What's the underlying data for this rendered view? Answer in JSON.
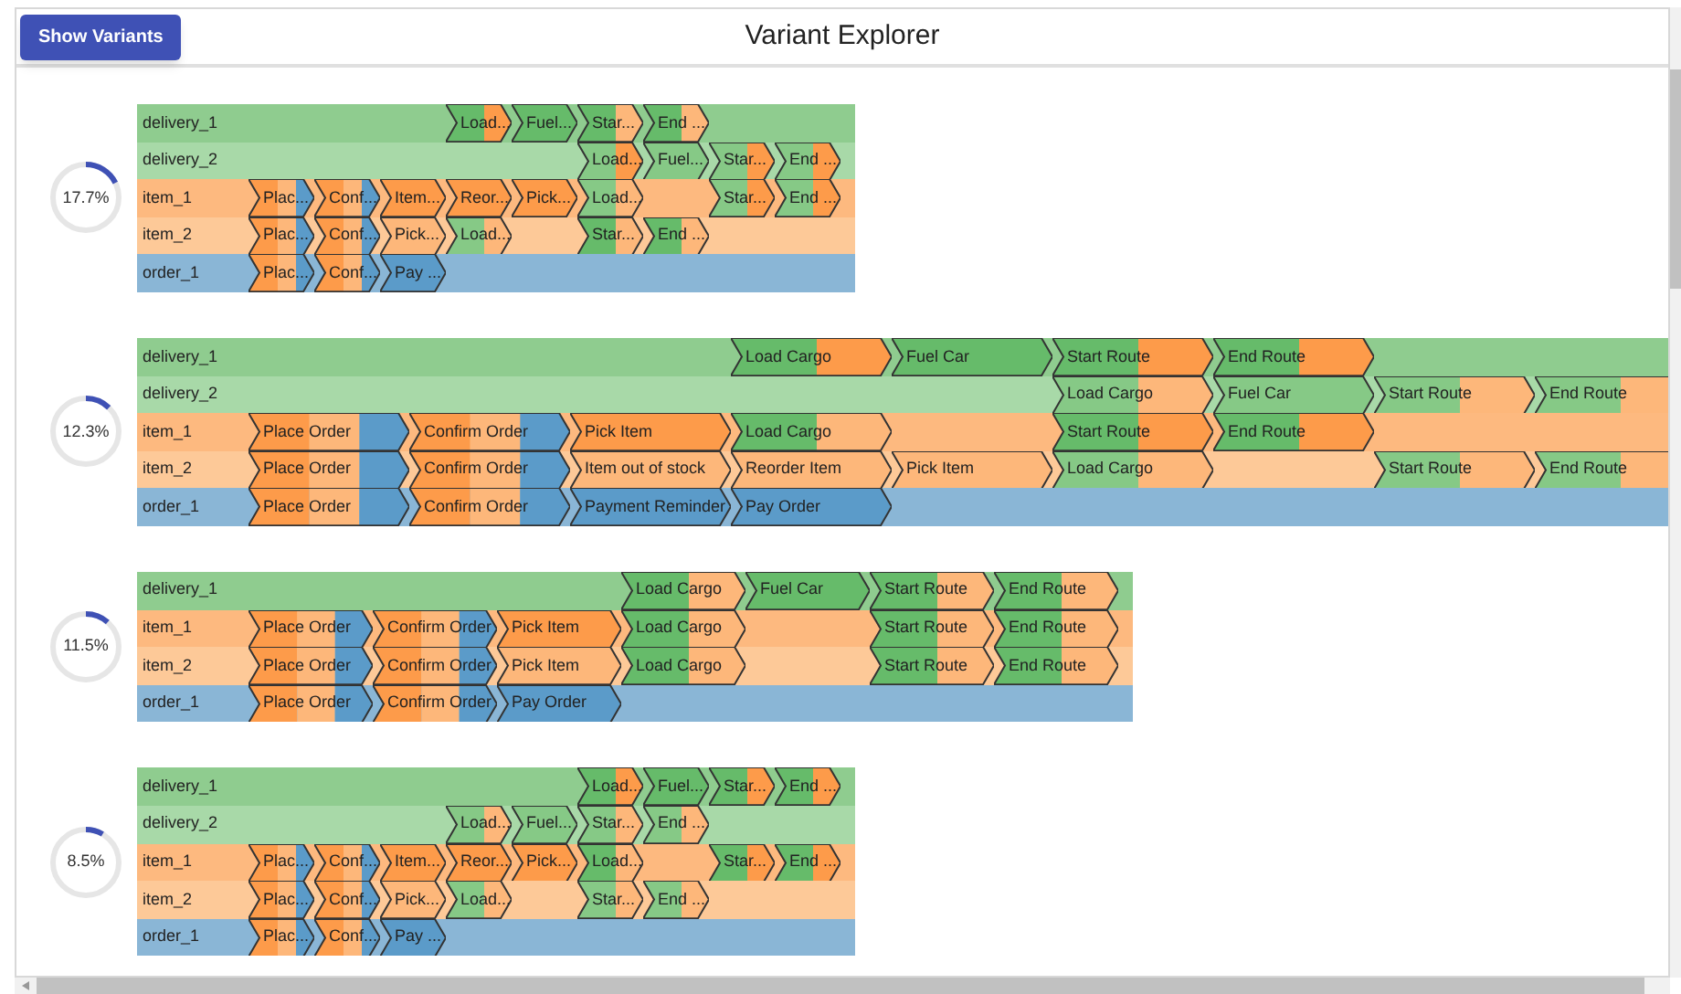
{
  "header": {
    "button": "Show Variants",
    "title": "Variant Explorer"
  },
  "variants": [
    {
      "share": "17.7%",
      "rows": [
        {
          "name": "delivery_1",
          "color": "#8fcc8f",
          "cells": [
            {
              "kind": "gap"
            },
            {
              "kind": "gap"
            },
            {
              "kind": "gap"
            },
            {
              "kind": "activity",
              "label": "Load...",
              "segments": [
                {
                  "color": "#66bb6a"
                },
                {
                  "color": "#fd9b4a"
                }
              ]
            },
            {
              "kind": "activity",
              "label": "Fuel...",
              "segments": [
                {
                  "color": "#66bb6a"
                }
              ]
            },
            {
              "kind": "activity",
              "label": "Star...",
              "segments": [
                {
                  "color": "#66bb6a"
                },
                {
                  "color": "#fdb77a"
                }
              ]
            },
            {
              "kind": "activity",
              "label": "End ...",
              "segments": [
                {
                  "color": "#66bb6a"
                },
                {
                  "color": "#fdb77a"
                }
              ]
            }
          ]
        },
        {
          "name": "delivery_2",
          "color": "#a8d9a8",
          "cells": [
            {
              "kind": "gap"
            },
            {
              "kind": "gap"
            },
            {
              "kind": "gap"
            },
            {
              "kind": "gap"
            },
            {
              "kind": "gap"
            },
            {
              "kind": "activity",
              "label": "Load...",
              "segments": [
                {
                  "color": "#86c986"
                },
                {
                  "color": "#fd9b4a"
                }
              ]
            },
            {
              "kind": "activity",
              "label": "Fuel...",
              "segments": [
                {
                  "color": "#86c986"
                }
              ]
            },
            {
              "kind": "activity",
              "label": "Star...",
              "segments": [
                {
                  "color": "#86c986"
                },
                {
                  "color": "#fd9b4a"
                }
              ]
            },
            {
              "kind": "activity",
              "label": "End ...",
              "segments": [
                {
                  "color": "#86c986"
                },
                {
                  "color": "#fd9b4a"
                }
              ]
            }
          ]
        },
        {
          "name": "item_1",
          "color": "#fdb97f",
          "cells": [
            {
              "kind": "activity",
              "label": "Plac...",
              "segments": [
                {
                  "color": "#fd9b4a"
                },
                {
                  "color": "#fdb77a"
                },
                {
                  "color": "#5b9bc9"
                }
              ]
            },
            {
              "kind": "activity",
              "label": "Conf...",
              "segments": [
                {
                  "color": "#fd9b4a"
                },
                {
                  "color": "#fdb77a"
                },
                {
                  "color": "#5b9bc9"
                }
              ]
            },
            {
              "kind": "activity",
              "label": "Item...",
              "segments": [
                {
                  "color": "#fd9b4a"
                }
              ]
            },
            {
              "kind": "activity",
              "label": "Reor...",
              "segments": [
                {
                  "color": "#fd9b4a"
                }
              ]
            },
            {
              "kind": "activity",
              "label": "Pick...",
              "segments": [
                {
                  "color": "#fd9b4a"
                }
              ]
            },
            {
              "kind": "activity",
              "label": "Load...",
              "segments": [
                {
                  "color": "#86c986"
                },
                {
                  "color": "#fdb77a"
                }
              ]
            },
            {
              "kind": "gap"
            },
            {
              "kind": "activity",
              "label": "Star...",
              "segments": [
                {
                  "color": "#86c986"
                },
                {
                  "color": "#fd9b4a"
                }
              ]
            },
            {
              "kind": "activity",
              "label": "End ...",
              "segments": [
                {
                  "color": "#86c986"
                },
                {
                  "color": "#fd9b4a"
                }
              ]
            }
          ]
        },
        {
          "name": "item_2",
          "color": "#fdc998",
          "cells": [
            {
              "kind": "activity",
              "label": "Plac...",
              "segments": [
                {
                  "color": "#fd9b4a"
                },
                {
                  "color": "#fdb77a"
                },
                {
                  "color": "#5b9bc9"
                }
              ]
            },
            {
              "kind": "activity",
              "label": "Conf...",
              "segments": [
                {
                  "color": "#fd9b4a"
                },
                {
                  "color": "#fdb77a"
                },
                {
                  "color": "#5b9bc9"
                }
              ]
            },
            {
              "kind": "activity",
              "label": "Pick...",
              "segments": [
                {
                  "color": "#fdb77a"
                }
              ]
            },
            {
              "kind": "activity",
              "label": "Load...",
              "segments": [
                {
                  "color": "#86c986"
                },
                {
                  "color": "#fdb77a"
                }
              ]
            },
            {
              "kind": "gap"
            },
            {
              "kind": "activity",
              "label": "Star...",
              "segments": [
                {
                  "color": "#66bb6a"
                },
                {
                  "color": "#fdb77a"
                }
              ]
            },
            {
              "kind": "activity",
              "label": "End ...",
              "segments": [
                {
                  "color": "#66bb6a"
                },
                {
                  "color": "#fdb77a"
                }
              ]
            }
          ]
        },
        {
          "name": "order_1",
          "color": "#8ab6d6",
          "cells": [
            {
              "kind": "activity",
              "label": "Plac...",
              "segments": [
                {
                  "color": "#fd9b4a"
                },
                {
                  "color": "#fdb77a"
                },
                {
                  "color": "#5b9bc9"
                }
              ]
            },
            {
              "kind": "activity",
              "label": "Conf...",
              "segments": [
                {
                  "color": "#fd9b4a"
                },
                {
                  "color": "#fdb77a"
                },
                {
                  "color": "#5b9bc9"
                }
              ]
            },
            {
              "kind": "activity",
              "label": "Pay ...",
              "segments": [
                {
                  "color": "#5b9bc9"
                }
              ]
            }
          ]
        }
      ]
    },
    {
      "share": "12.3%",
      "rows": [
        {
          "name": "delivery_1",
          "color": "#8fcc8f",
          "cells": [
            {
              "kind": "gap"
            },
            {
              "kind": "gap"
            },
            {
              "kind": "gap"
            },
            {
              "kind": "activity",
              "label": "Load Cargo",
              "segments": [
                {
                  "color": "#66bb6a"
                },
                {
                  "color": "#fd9b4a"
                }
              ]
            },
            {
              "kind": "activity",
              "label": "Fuel Car",
              "segments": [
                {
                  "color": "#66bb6a"
                }
              ]
            },
            {
              "kind": "activity",
              "label": "Start Route",
              "segments": [
                {
                  "color": "#66bb6a"
                },
                {
                  "color": "#fd9b4a"
                }
              ]
            },
            {
              "kind": "activity",
              "label": "End Route",
              "segments": [
                {
                  "color": "#66bb6a"
                },
                {
                  "color": "#fd9b4a"
                }
              ]
            }
          ]
        },
        {
          "name": "delivery_2",
          "color": "#a8d9a8",
          "cells": [
            {
              "kind": "gap"
            },
            {
              "kind": "gap"
            },
            {
              "kind": "gap"
            },
            {
              "kind": "gap"
            },
            {
              "kind": "gap"
            },
            {
              "kind": "activity",
              "label": "Load Cargo",
              "segments": [
                {
                  "color": "#86c986"
                },
                {
                  "color": "#fdb77a"
                }
              ]
            },
            {
              "kind": "activity",
              "label": "Fuel Car",
              "segments": [
                {
                  "color": "#86c986"
                }
              ]
            },
            {
              "kind": "activity",
              "label": "Start Route",
              "segments": [
                {
                  "color": "#86c986"
                },
                {
                  "color": "#fdb77a"
                }
              ]
            },
            {
              "kind": "activity",
              "label": "End Route",
              "segments": [
                {
                  "color": "#86c986"
                },
                {
                  "color": "#fdb77a"
                }
              ]
            }
          ]
        },
        {
          "name": "item_1",
          "color": "#fdb97f",
          "cells": [
            {
              "kind": "activity",
              "label": "Place Order",
              "segments": [
                {
                  "color": "#fd9b4a"
                },
                {
                  "color": "#fdb77a"
                },
                {
                  "color": "#5b9bc9"
                }
              ]
            },
            {
              "kind": "activity",
              "label": "Confirm Order",
              "segments": [
                {
                  "color": "#fd9b4a"
                },
                {
                  "color": "#fdb77a"
                },
                {
                  "color": "#5b9bc9"
                }
              ]
            },
            {
              "kind": "activity",
              "label": "Pick Item",
              "segments": [
                {
                  "color": "#fd9b4a"
                }
              ]
            },
            {
              "kind": "activity",
              "label": "Load Cargo",
              "segments": [
                {
                  "color": "#66bb6a"
                },
                {
                  "color": "#fdb77a"
                }
              ]
            },
            {
              "kind": "gap"
            },
            {
              "kind": "activity",
              "label": "Start Route",
              "segments": [
                {
                  "color": "#66bb6a"
                },
                {
                  "color": "#fd9b4a"
                }
              ]
            },
            {
              "kind": "activity",
              "label": "End Route",
              "segments": [
                {
                  "color": "#66bb6a"
                },
                {
                  "color": "#fd9b4a"
                }
              ]
            }
          ]
        },
        {
          "name": "item_2",
          "color": "#fdc998",
          "cells": [
            {
              "kind": "activity",
              "label": "Place Order",
              "segments": [
                {
                  "color": "#fd9b4a"
                },
                {
                  "color": "#fdb77a"
                },
                {
                  "color": "#5b9bc9"
                }
              ]
            },
            {
              "kind": "activity",
              "label": "Confirm Order",
              "segments": [
                {
                  "color": "#fd9b4a"
                },
                {
                  "color": "#fdb77a"
                },
                {
                  "color": "#5b9bc9"
                }
              ]
            },
            {
              "kind": "activity",
              "label": "Item out of stock",
              "segments": [
                {
                  "color": "#fdb77a"
                }
              ]
            },
            {
              "kind": "activity",
              "label": "Reorder Item",
              "segments": [
                {
                  "color": "#fdb77a"
                }
              ]
            },
            {
              "kind": "activity",
              "label": "Pick Item",
              "segments": [
                {
                  "color": "#fdb77a"
                }
              ]
            },
            {
              "kind": "activity",
              "label": "Load Cargo",
              "segments": [
                {
                  "color": "#86c986"
                },
                {
                  "color": "#fdb77a"
                }
              ]
            },
            {
              "kind": "gap"
            },
            {
              "kind": "activity",
              "label": "Start Route",
              "segments": [
                {
                  "color": "#86c986"
                },
                {
                  "color": "#fdb77a"
                }
              ]
            },
            {
              "kind": "activity",
              "label": "End Route",
              "segments": [
                {
                  "color": "#86c986"
                },
                {
                  "color": "#fdb77a"
                }
              ]
            }
          ]
        },
        {
          "name": "order_1",
          "color": "#8ab6d6",
          "cells": [
            {
              "kind": "activity",
              "label": "Place Order",
              "segments": [
                {
                  "color": "#fd9b4a"
                },
                {
                  "color": "#fdb77a"
                },
                {
                  "color": "#5b9bc9"
                }
              ]
            },
            {
              "kind": "activity",
              "label": "Confirm Order",
              "segments": [
                {
                  "color": "#fd9b4a"
                },
                {
                  "color": "#fdb77a"
                },
                {
                  "color": "#5b9bc9"
                }
              ]
            },
            {
              "kind": "activity",
              "label": "Payment Reminder",
              "segments": [
                {
                  "color": "#5b9bc9"
                }
              ]
            },
            {
              "kind": "activity",
              "label": "Pay Order",
              "segments": [
                {
                  "color": "#5b9bc9"
                }
              ]
            }
          ]
        }
      ]
    },
    {
      "share": "11.5%",
      "rows": [
        {
          "name": "delivery_1",
          "color": "#8fcc8f",
          "cells": [
            {
              "kind": "gap"
            },
            {
              "kind": "gap"
            },
            {
              "kind": "gap"
            },
            {
              "kind": "activity",
              "label": "Load Cargo",
              "segments": [
                {
                  "color": "#66bb6a"
                },
                {
                  "color": "#fdb77a"
                }
              ]
            },
            {
              "kind": "activity",
              "label": "Fuel Car",
              "segments": [
                {
                  "color": "#66bb6a"
                }
              ]
            },
            {
              "kind": "activity",
              "label": "Start Route",
              "segments": [
                {
                  "color": "#66bb6a"
                },
                {
                  "color": "#fdb77a"
                }
              ]
            },
            {
              "kind": "activity",
              "label": "End Route",
              "segments": [
                {
                  "color": "#66bb6a"
                },
                {
                  "color": "#fdb77a"
                }
              ]
            }
          ]
        },
        {
          "name": "item_1",
          "color": "#fdb97f",
          "cells": [
            {
              "kind": "activity",
              "label": "Place Order",
              "segments": [
                {
                  "color": "#fd9b4a"
                },
                {
                  "color": "#fdb77a"
                },
                {
                  "color": "#5b9bc9"
                }
              ]
            },
            {
              "kind": "activity",
              "label": "Confirm Order",
              "segments": [
                {
                  "color": "#fd9b4a"
                },
                {
                  "color": "#fdb77a"
                },
                {
                  "color": "#5b9bc9"
                }
              ]
            },
            {
              "kind": "activity",
              "label": "Pick Item",
              "segments": [
                {
                  "color": "#fd9b4a"
                }
              ]
            },
            {
              "kind": "activity",
              "label": "Load Cargo",
              "segments": [
                {
                  "color": "#66bb6a"
                },
                {
                  "color": "#fdb77a"
                }
              ]
            },
            {
              "kind": "gap"
            },
            {
              "kind": "activity",
              "label": "Start Route",
              "segments": [
                {
                  "color": "#66bb6a"
                },
                {
                  "color": "#fdb77a"
                }
              ]
            },
            {
              "kind": "activity",
              "label": "End Route",
              "segments": [
                {
                  "color": "#66bb6a"
                },
                {
                  "color": "#fdb77a"
                }
              ]
            }
          ]
        },
        {
          "name": "item_2",
          "color": "#fdc998",
          "cells": [
            {
              "kind": "activity",
              "label": "Place Order",
              "segments": [
                {
                  "color": "#fd9b4a"
                },
                {
                  "color": "#fdb77a"
                },
                {
                  "color": "#5b9bc9"
                }
              ]
            },
            {
              "kind": "activity",
              "label": "Confirm Order",
              "segments": [
                {
                  "color": "#fd9b4a"
                },
                {
                  "color": "#fdb77a"
                },
                {
                  "color": "#5b9bc9"
                }
              ]
            },
            {
              "kind": "activity",
              "label": "Pick Item",
              "segments": [
                {
                  "color": "#fdb77a"
                }
              ]
            },
            {
              "kind": "activity",
              "label": "Load Cargo",
              "segments": [
                {
                  "color": "#66bb6a"
                },
                {
                  "color": "#fdb77a"
                }
              ]
            },
            {
              "kind": "gap"
            },
            {
              "kind": "activity",
              "label": "Start Route",
              "segments": [
                {
                  "color": "#66bb6a"
                },
                {
                  "color": "#fdb77a"
                }
              ]
            },
            {
              "kind": "activity",
              "label": "End Route",
              "segments": [
                {
                  "color": "#66bb6a"
                },
                {
                  "color": "#fdb77a"
                }
              ]
            }
          ]
        },
        {
          "name": "order_1",
          "color": "#8ab6d6",
          "cells": [
            {
              "kind": "activity",
              "label": "Place Order",
              "segments": [
                {
                  "color": "#fd9b4a"
                },
                {
                  "color": "#fdb77a"
                },
                {
                  "color": "#5b9bc9"
                }
              ]
            },
            {
              "kind": "activity",
              "label": "Confirm Order",
              "segments": [
                {
                  "color": "#fd9b4a"
                },
                {
                  "color": "#fdb77a"
                },
                {
                  "color": "#5b9bc9"
                }
              ]
            },
            {
              "kind": "activity",
              "label": "Pay Order",
              "segments": [
                {
                  "color": "#5b9bc9"
                }
              ]
            }
          ]
        }
      ]
    },
    {
      "share": "8.5%",
      "rows": [
        {
          "name": "delivery_1",
          "color": "#8fcc8f",
          "cells": [
            {
              "kind": "gap"
            },
            {
              "kind": "gap"
            },
            {
              "kind": "gap"
            },
            {
              "kind": "gap"
            },
            {
              "kind": "gap"
            },
            {
              "kind": "activity",
              "label": "Load...",
              "segments": [
                {
                  "color": "#66bb6a"
                },
                {
                  "color": "#fd9b4a"
                }
              ]
            },
            {
              "kind": "activity",
              "label": "Fuel...",
              "segments": [
                {
                  "color": "#66bb6a"
                }
              ]
            },
            {
              "kind": "activity",
              "label": "Star...",
              "segments": [
                {
                  "color": "#66bb6a"
                },
                {
                  "color": "#fd9b4a"
                }
              ]
            },
            {
              "kind": "activity",
              "label": "End ...",
              "segments": [
                {
                  "color": "#66bb6a"
                },
                {
                  "color": "#fd9b4a"
                }
              ]
            }
          ]
        },
        {
          "name": "delivery_2",
          "color": "#a8d9a8",
          "cells": [
            {
              "kind": "gap"
            },
            {
              "kind": "gap"
            },
            {
              "kind": "gap"
            },
            {
              "kind": "activity",
              "label": "Load...",
              "segments": [
                {
                  "color": "#86c986"
                },
                {
                  "color": "#fdb77a"
                }
              ]
            },
            {
              "kind": "activity",
              "label": "Fuel...",
              "segments": [
                {
                  "color": "#86c986"
                }
              ]
            },
            {
              "kind": "activity",
              "label": "Star...",
              "segments": [
                {
                  "color": "#86c986"
                },
                {
                  "color": "#fdb77a"
                }
              ]
            },
            {
              "kind": "activity",
              "label": "End ...",
              "segments": [
                {
                  "color": "#86c986"
                },
                {
                  "color": "#fdb77a"
                }
              ]
            }
          ]
        },
        {
          "name": "item_1",
          "color": "#fdb97f",
          "cells": [
            {
              "kind": "activity",
              "label": "Plac...",
              "segments": [
                {
                  "color": "#fd9b4a"
                },
                {
                  "color": "#fdb77a"
                },
                {
                  "color": "#5b9bc9"
                }
              ]
            },
            {
              "kind": "activity",
              "label": "Conf...",
              "segments": [
                {
                  "color": "#fd9b4a"
                },
                {
                  "color": "#fdb77a"
                },
                {
                  "color": "#5b9bc9"
                }
              ]
            },
            {
              "kind": "activity",
              "label": "Item...",
              "segments": [
                {
                  "color": "#fd9b4a"
                }
              ]
            },
            {
              "kind": "activity",
              "label": "Reor...",
              "segments": [
                {
                  "color": "#fd9b4a"
                }
              ]
            },
            {
              "kind": "activity",
              "label": "Pick...",
              "segments": [
                {
                  "color": "#fd9b4a"
                }
              ]
            },
            {
              "kind": "activity",
              "label": "Load...",
              "segments": [
                {
                  "color": "#66bb6a"
                },
                {
                  "color": "#fdb77a"
                }
              ]
            },
            {
              "kind": "gap"
            },
            {
              "kind": "activity",
              "label": "Star...",
              "segments": [
                {
                  "color": "#66bb6a"
                },
                {
                  "color": "#fd9b4a"
                }
              ]
            },
            {
              "kind": "activity",
              "label": "End ...",
              "segments": [
                {
                  "color": "#66bb6a"
                },
                {
                  "color": "#fd9b4a"
                }
              ]
            }
          ]
        },
        {
          "name": "item_2",
          "color": "#fdc998",
          "cells": [
            {
              "kind": "activity",
              "label": "Plac...",
              "segments": [
                {
                  "color": "#fd9b4a"
                },
                {
                  "color": "#fdb77a"
                },
                {
                  "color": "#5b9bc9"
                }
              ]
            },
            {
              "kind": "activity",
              "label": "Conf...",
              "segments": [
                {
                  "color": "#fd9b4a"
                },
                {
                  "color": "#fdb77a"
                },
                {
                  "color": "#5b9bc9"
                }
              ]
            },
            {
              "kind": "activity",
              "label": "Pick...",
              "segments": [
                {
                  "color": "#fdb77a"
                }
              ]
            },
            {
              "kind": "activity",
              "label": "Load...",
              "segments": [
                {
                  "color": "#86c986"
                },
                {
                  "color": "#fdb77a"
                }
              ]
            },
            {
              "kind": "gap"
            },
            {
              "kind": "activity",
              "label": "Star...",
              "segments": [
                {
                  "color": "#86c986"
                },
                {
                  "color": "#fdb77a"
                }
              ]
            },
            {
              "kind": "activity",
              "label": "End ...",
              "segments": [
                {
                  "color": "#86c986"
                },
                {
                  "color": "#fdb77a"
                }
              ]
            }
          ]
        },
        {
          "name": "order_1",
          "color": "#8ab6d6",
          "cells": [
            {
              "kind": "activity",
              "label": "Plac...",
              "segments": [
                {
                  "color": "#fd9b4a"
                },
                {
                  "color": "#fdb77a"
                },
                {
                  "color": "#5b9bc9"
                }
              ]
            },
            {
              "kind": "activity",
              "label": "Conf...",
              "segments": [
                {
                  "color": "#fd9b4a"
                },
                {
                  "color": "#fdb77a"
                },
                {
                  "color": "#5b9bc9"
                }
              ]
            },
            {
              "kind": "activity",
              "label": "Pay ...",
              "segments": [
                {
                  "color": "#5b9bc9"
                }
              ]
            }
          ]
        }
      ]
    }
  ]
}
